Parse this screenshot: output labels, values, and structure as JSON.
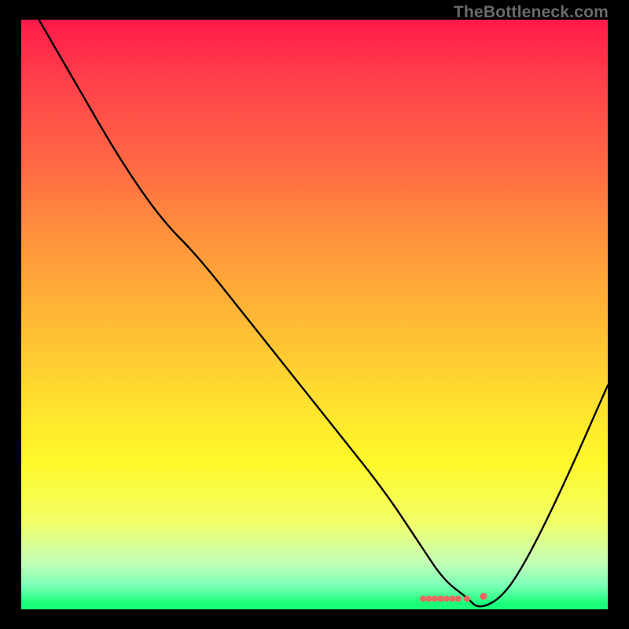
{
  "watermark": "TheBottleneck.com",
  "chart_data": {
    "type": "line",
    "title": "",
    "xlabel": "",
    "ylabel": "",
    "xlim": [
      0,
      100
    ],
    "ylim": [
      0,
      100
    ],
    "series": [
      {
        "name": "bottleneck-curve",
        "x": [
          3,
          10,
          17,
          24,
          30,
          38,
          46,
          54,
          62,
          68,
          72,
          76,
          78,
          82,
          86,
          92,
          100
        ],
        "y": [
          100,
          88,
          76,
          66,
          60,
          50,
          40,
          30,
          20,
          11,
          5,
          2,
          0,
          2,
          8,
          20,
          38
        ]
      }
    ],
    "markers": {
      "name": "highlight-cluster",
      "x": [
        68.5,
        69.5,
        70.5,
        71.5,
        72.5,
        73.5,
        74.5,
        76,
        78.8
      ],
      "y": [
        1.8,
        1.8,
        1.8,
        1.8,
        1.8,
        1.8,
        1.8,
        1.8,
        2.2
      ]
    },
    "background_gradient": {
      "top": "#ff1a4a",
      "mid": "#ffd930",
      "bottom": "#1aff7a"
    }
  }
}
